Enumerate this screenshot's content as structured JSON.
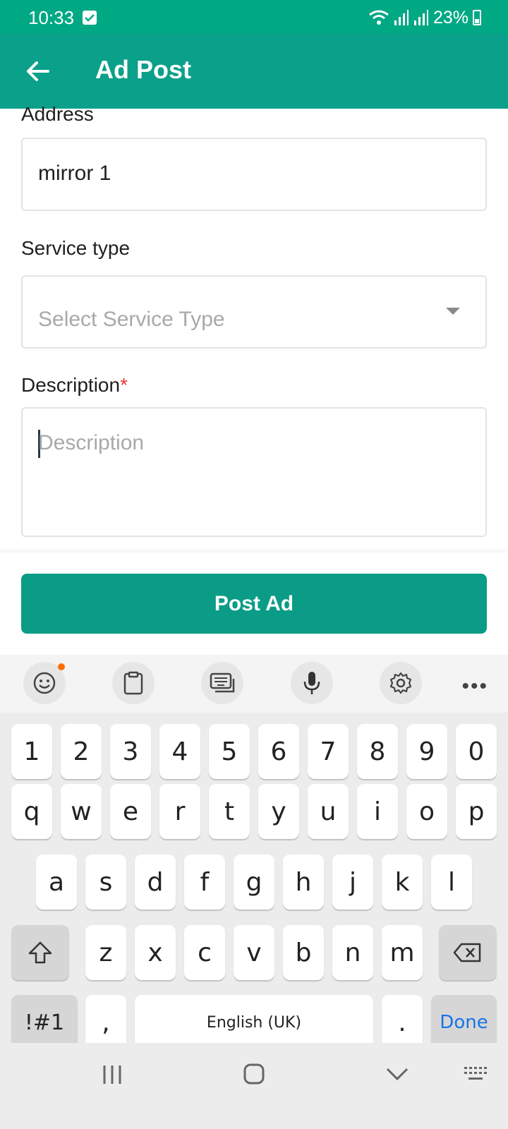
{
  "status_bar": {
    "time": "10:33",
    "battery": "23%"
  },
  "app_bar": {
    "title": "Ad Post"
  },
  "form": {
    "address_label": "Address",
    "address_value": "mirror 1",
    "service_type_label": "Service type",
    "service_type_placeholder": "Select Service Type",
    "description_label": "Description",
    "description_required": "*",
    "description_placeholder": "Description"
  },
  "actions": {
    "post_ad_label": "Post Ad"
  },
  "keyboard": {
    "row_numbers": [
      "1",
      "2",
      "3",
      "4",
      "5",
      "6",
      "7",
      "8",
      "9",
      "0"
    ],
    "row_1": [
      "q",
      "w",
      "e",
      "r",
      "t",
      "y",
      "u",
      "i",
      "o",
      "p"
    ],
    "row_2": [
      "a",
      "s",
      "d",
      "f",
      "g",
      "h",
      "j",
      "k",
      "l"
    ],
    "row_3": [
      "z",
      "x",
      "c",
      "v",
      "b",
      "n",
      "m"
    ],
    "symbols_label": "!#1",
    "comma": ",",
    "space_label": "English (UK)",
    "period": ".",
    "done_label": "Done"
  },
  "colors": {
    "status_bar": "#00a884",
    "app_bar": "#0aa08a",
    "button": "#0a9c86"
  }
}
